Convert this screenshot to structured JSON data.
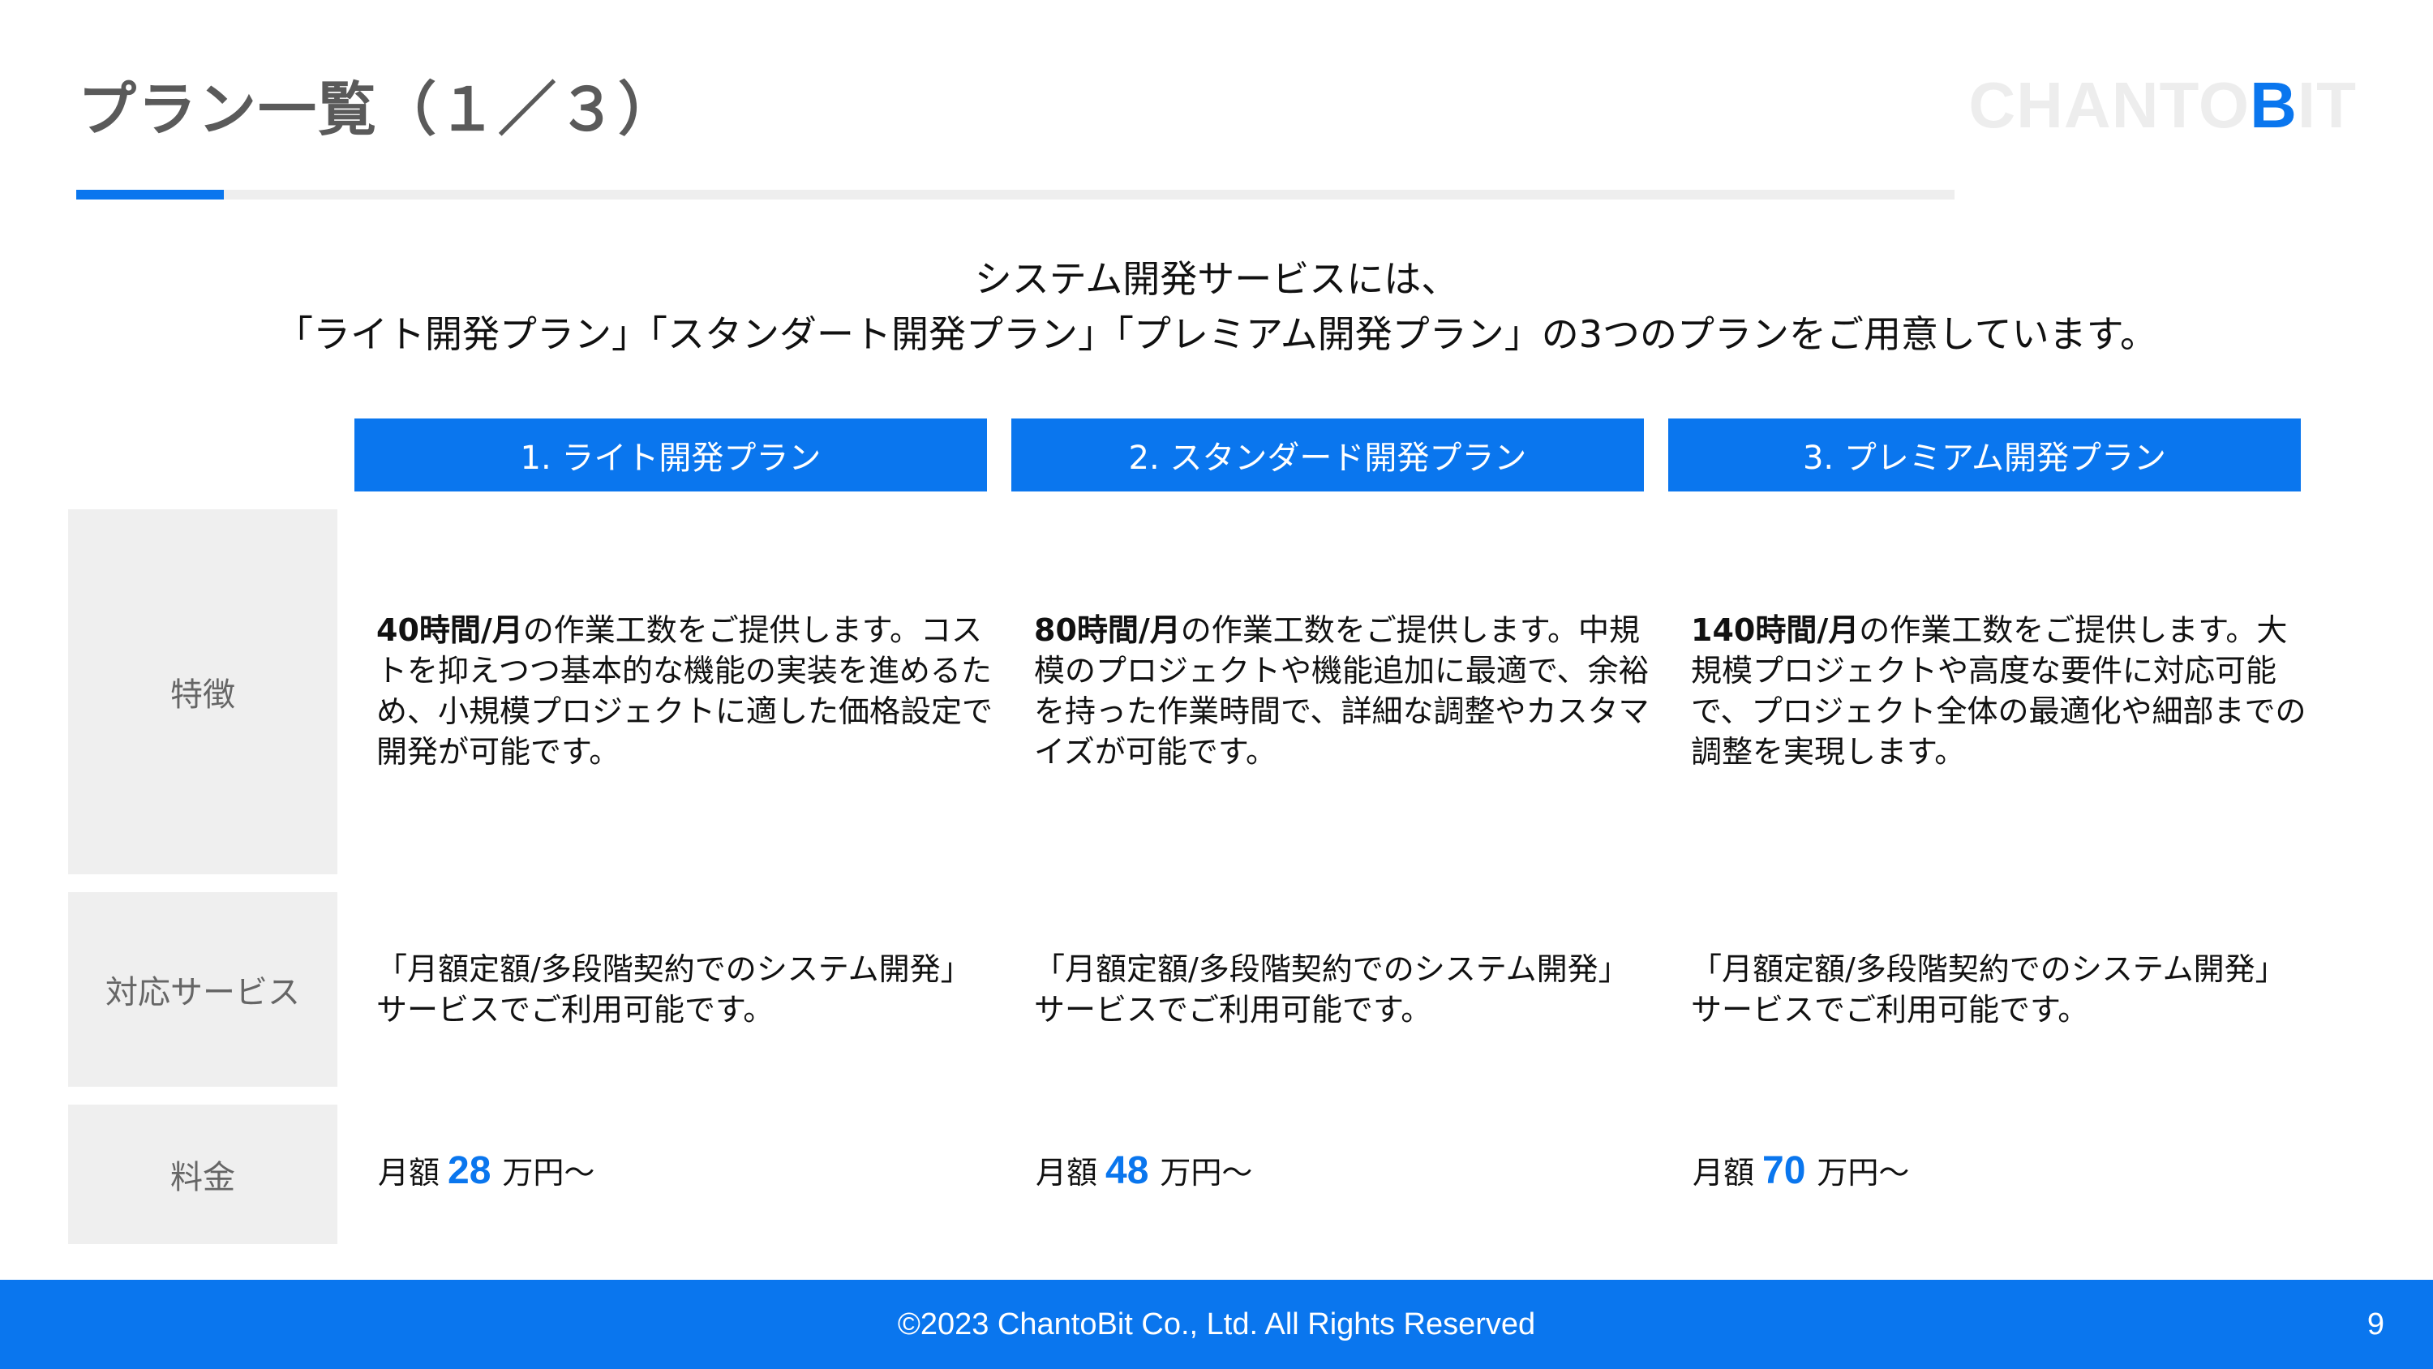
{
  "header": {
    "title": "プラン一覧（１／３）",
    "logo_main": "CHANTO",
    "logo_accent": "B",
    "logo_tail": "IT"
  },
  "intro": {
    "line1": "システム開発サービスには、",
    "line2": "「ライト開発プラン」「スタンダート開発プラン」「プレミアム開発プラン」の3つのプランをご用意しています。"
  },
  "plans": [
    {
      "header": "1. ライト開発プラン",
      "features_bold": "40時間/月",
      "features_text": "の作業工数をご提供します。コストを抑えつつ基本的な機能の実装を進めるため、小規模プロジェクトに適した価格設定で開発が可能です。",
      "service": "「月額定額/多段階契約でのシステム開発」サービスでご利用可能です。",
      "price_prefix": "月額",
      "price_value": "28",
      "price_suffix": "万円～"
    },
    {
      "header": "2. スタンダード開発プラン",
      "features_bold": "80時間/月",
      "features_text": "の作業工数をご提供します。中規模のプロジェクトや機能追加に最適で、余裕を持った作業時間で、詳細な調整やカスタマイズが可能です。",
      "service": "「月額定額/多段階契約でのシステム開発」サービスでご利用可能です。",
      "price_prefix": "月額",
      "price_value": "48",
      "price_suffix": "万円～"
    },
    {
      "header": "3. プレミアム開発プラン",
      "features_bold": "140時間/月",
      "features_text": "の作業工数をご提供します。大規模プロジェクトや高度な要件に対応可能で、プロジェクト全体の最適化や細部までの調整を実現します。",
      "service": "「月額定額/多段階契約でのシステム開発」サービスでご利用可能です。",
      "price_prefix": "月額",
      "price_value": "70",
      "price_suffix": "万円～"
    }
  ],
  "rows": {
    "features": "特徴",
    "service": "対応サービス",
    "price": "料金"
  },
  "footer": {
    "copyright": "©2023 ChantoBit Co., Ltd. All Rights Reserved",
    "page_number": "9"
  },
  "colors": {
    "accent": "#0a76ee",
    "label_bg": "#efefef",
    "title": "#5a5a5a"
  }
}
